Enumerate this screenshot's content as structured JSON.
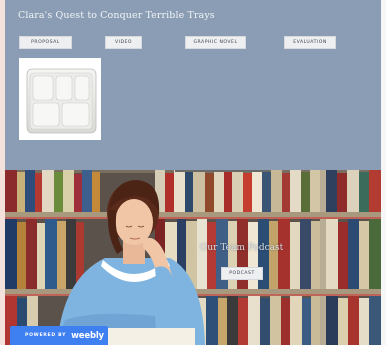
{
  "site": {
    "title": "Clara's Quest to Conquer Terrible Trays"
  },
  "nav": {
    "items": [
      {
        "label": "PROPOSAL"
      },
      {
        "label": "VIDEO"
      },
      {
        "label": "GRAPHIC NOVEL"
      },
      {
        "label": "EVALUATION"
      }
    ]
  },
  "hero": {
    "title": "Our Team Podcast",
    "button_label": "PODCAST"
  },
  "footer_badge": {
    "prefix": "POWERED BY",
    "brand": "weebly"
  },
  "colors": {
    "header_bg": "#8a9db4",
    "button_bg": "#eeeff1",
    "badge_bg": "#3e7ff1"
  },
  "icons": [
    "lunch-tray-image",
    "bookshelf-photo"
  ]
}
